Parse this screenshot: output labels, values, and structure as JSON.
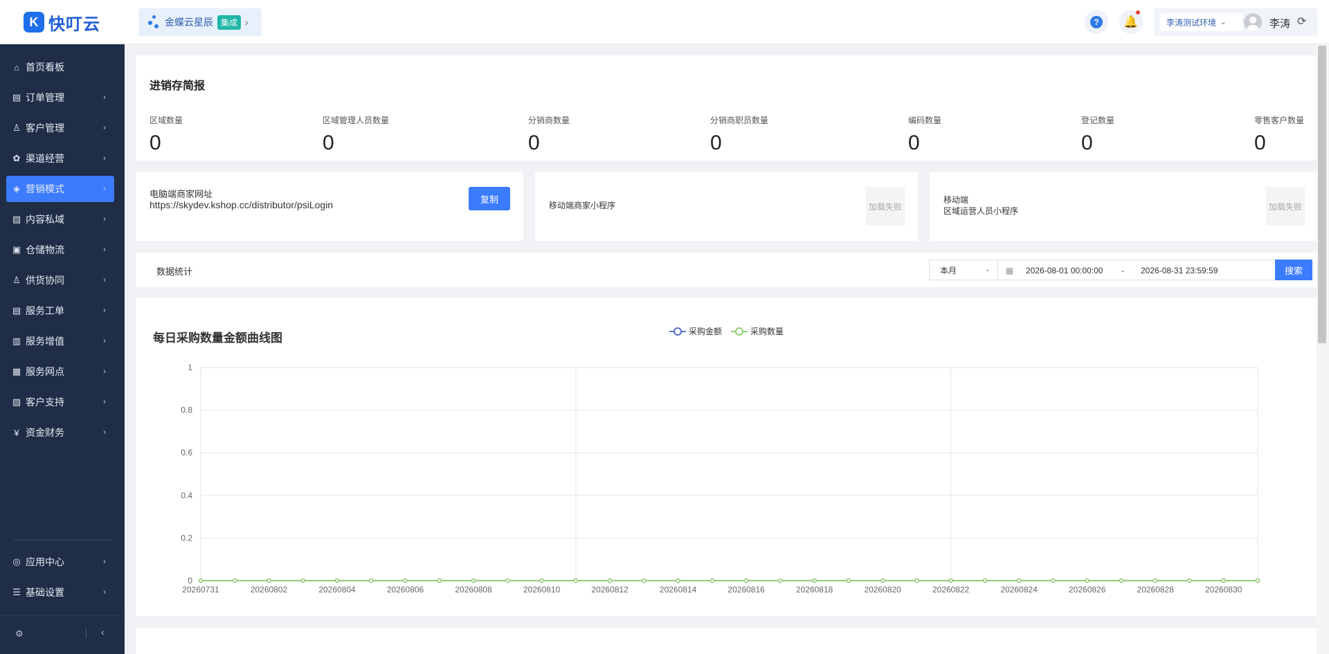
{
  "brand": {
    "mark": "K",
    "name": "快叮云"
  },
  "integration": {
    "name": "金蝶云星辰",
    "badge": "集成",
    "arrow": "›"
  },
  "header": {
    "help": "?",
    "bell": "🔔",
    "env": "李涛测试环境",
    "env_chevron": "⌄",
    "user": "李涛",
    "refresh": "⟳"
  },
  "sidebar": {
    "items": [
      {
        "label": "首页看板",
        "icon": "home-icon",
        "glyph": "⌂",
        "arrow": ""
      },
      {
        "label": "订单管理",
        "icon": "order-icon",
        "glyph": "▤",
        "arrow": "›"
      },
      {
        "label": "客户管理",
        "icon": "customer-icon",
        "glyph": "♙",
        "arrow": "›"
      },
      {
        "label": "渠道经营",
        "icon": "channel-icon",
        "glyph": "✿",
        "arrow": "›"
      },
      {
        "label": "营销模式",
        "icon": "marketing-icon",
        "glyph": "◈",
        "arrow": "›"
      },
      {
        "label": "内容私域",
        "icon": "content-icon",
        "glyph": "▧",
        "arrow": "›"
      },
      {
        "label": "仓储物流",
        "icon": "warehouse-icon",
        "glyph": "▣",
        "arrow": "›"
      },
      {
        "label": "供货协同",
        "icon": "supply-icon",
        "glyph": "♙",
        "arrow": "›"
      },
      {
        "label": "服务工单",
        "icon": "ticket-icon",
        "glyph": "▤",
        "arrow": "›"
      },
      {
        "label": "服务增值",
        "icon": "bag-icon",
        "glyph": "▥",
        "arrow": "›"
      },
      {
        "label": "服务网点",
        "icon": "store-icon",
        "glyph": "▦",
        "arrow": "›"
      },
      {
        "label": "客户支持",
        "icon": "support-icon",
        "glyph": "▨",
        "arrow": "›"
      },
      {
        "label": "资金财务",
        "icon": "finance-icon",
        "glyph": "¥",
        "arrow": "›"
      }
    ],
    "bottom_items": [
      {
        "label": "应用中心",
        "icon": "app-center-icon",
        "glyph": "◎",
        "arrow": "›"
      },
      {
        "label": "基础设置",
        "icon": "settings-list-icon",
        "glyph": "☰",
        "arrow": "›"
      }
    ],
    "footer": {
      "gear": "⚙",
      "collapse": "‹"
    }
  },
  "summary": {
    "title": "进销存简报",
    "stats": [
      {
        "label": "区域数量",
        "value": "0"
      },
      {
        "label": "区域管理人员数量",
        "value": "0"
      },
      {
        "label": "分销商数量",
        "value": "0"
      },
      {
        "label": "分销商职员数量",
        "value": "0"
      },
      {
        "label": "编码数量",
        "value": "0"
      },
      {
        "label": "登记数量",
        "value": "0"
      },
      {
        "label": "零售客户数量",
        "value": "0"
      }
    ]
  },
  "links": {
    "pc_label": "电脑端商家网址",
    "pc_url": "https://skydev.kshop.cc/distributor/psiLogin",
    "copy": "复制",
    "mini_label": "移动端商家小程序",
    "mini_status": "加载失败",
    "region_label_1": "移动端",
    "region_label_2": "区域运营人员小程序",
    "region_status": "加载失败"
  },
  "stats_filter": {
    "title": "数据统计",
    "period": "本月",
    "period_chevron": "⌄",
    "calendar": "▦",
    "start": "2026-08-01 00:00:00",
    "sep": "-",
    "end": "2026-08-31 23:59:59",
    "search": "搜索"
  },
  "colors": {
    "accent": "#3b7cff",
    "sidebar": "#1f2d47",
    "series_amount": "#5470c6",
    "series_qty": "#91cc75"
  },
  "chart_data": {
    "type": "line",
    "title": "每日采购数量金额曲线图",
    "x": [
      "20260731",
      "20260801",
      "20260802",
      "20260803",
      "20260804",
      "20260805",
      "20260806",
      "20260807",
      "20260808",
      "20260809",
      "20260810",
      "20260811",
      "20260812",
      "20260813",
      "20260814",
      "20260815",
      "20260816",
      "20260817",
      "20260818",
      "20260819",
      "20260820",
      "20260821",
      "20260822",
      "20260823",
      "20260824",
      "20260825",
      "20260826",
      "20260827",
      "20260828",
      "20260829",
      "20260830",
      "20260831"
    ],
    "xtick_labels": [
      "20260731",
      "20260802",
      "20260804",
      "20260806",
      "20260808",
      "20260810",
      "20260812",
      "20260814",
      "20260816",
      "20260818",
      "20260820",
      "20260822",
      "20260824",
      "20260826",
      "20260828",
      "20260830"
    ],
    "series": [
      {
        "name": "采购金额",
        "values": [
          0,
          0,
          0,
          0,
          0,
          0,
          0,
          0,
          0,
          0,
          0,
          0,
          0,
          0,
          0,
          0,
          0,
          0,
          0,
          0,
          0,
          0,
          0,
          0,
          0,
          0,
          0,
          0,
          0,
          0,
          0,
          0
        ]
      },
      {
        "name": "采购数量",
        "values": [
          0,
          0,
          0,
          0,
          0,
          0,
          0,
          0,
          0,
          0,
          0,
          0,
          0,
          0,
          0,
          0,
          0,
          0,
          0,
          0,
          0,
          0,
          0,
          0,
          0,
          0,
          0,
          0,
          0,
          0,
          0,
          0
        ]
      }
    ],
    "yticks": [
      "0",
      "0.2",
      "0.4",
      "0.6",
      "0.8",
      "1"
    ],
    "ylim": [
      0,
      1
    ],
    "legend": "top-center",
    "grid": true
  }
}
